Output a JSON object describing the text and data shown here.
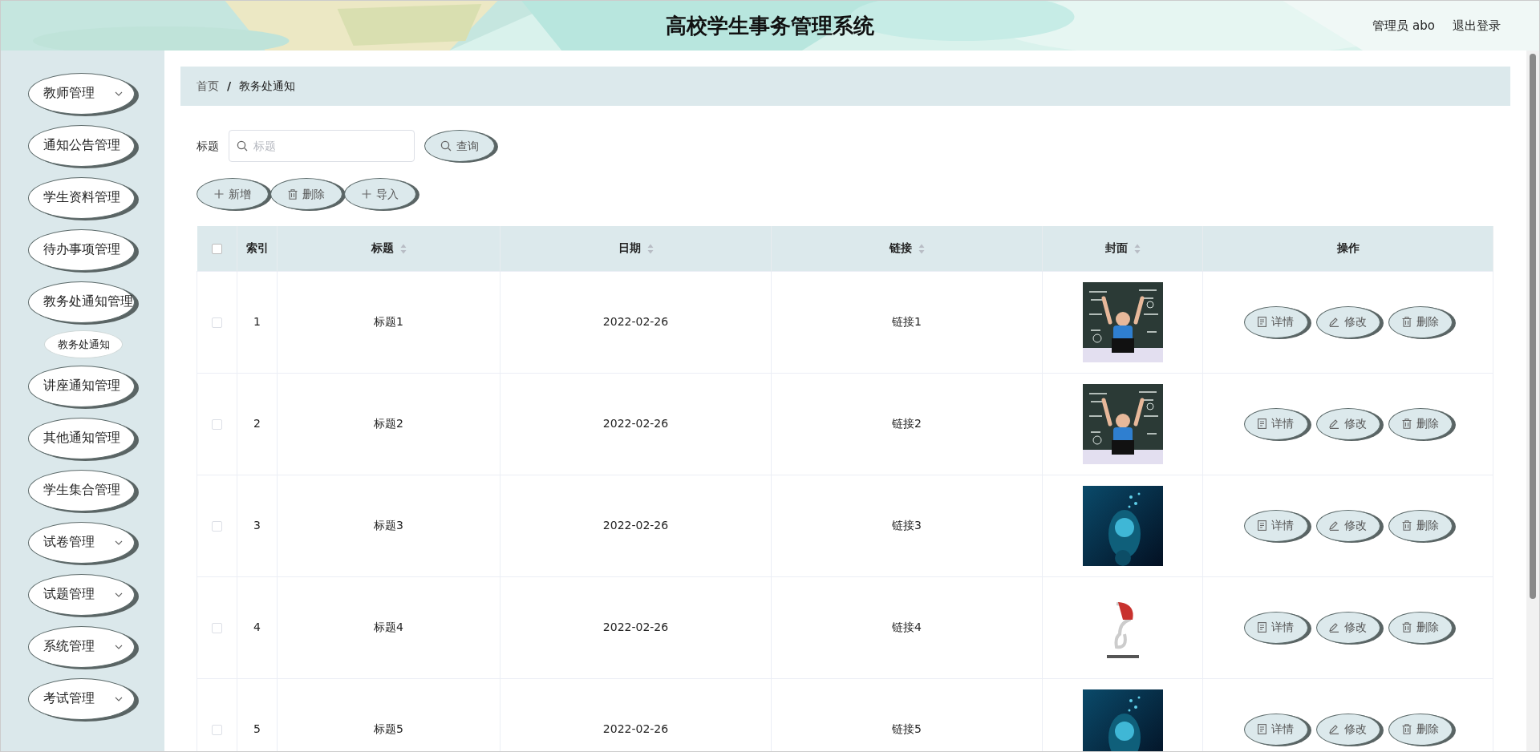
{
  "header": {
    "title": "高校学生事务管理系统",
    "user": "管理员 abo",
    "logout": "退出登录"
  },
  "sidebar": {
    "items": [
      {
        "label": "教师管理",
        "caret": true,
        "expanded": false
      },
      {
        "label": "通知公告管理",
        "caret": false
      },
      {
        "label": "学生资料管理",
        "caret": false
      },
      {
        "label": "待办事项管理",
        "caret": false
      },
      {
        "label": "教务处通知管理",
        "caret": false,
        "expanded": true,
        "children": [
          {
            "label": "教务处通知",
            "selected": true
          }
        ]
      },
      {
        "label": "讲座通知管理",
        "caret": false
      },
      {
        "label": "其他通知管理",
        "caret": false
      },
      {
        "label": "学生集合管理",
        "caret": false
      },
      {
        "label": "试卷管理",
        "caret": true,
        "expanded": false
      },
      {
        "label": "试题管理",
        "caret": true,
        "expanded": false
      },
      {
        "label": "系统管理",
        "caret": true,
        "expanded": false
      },
      {
        "label": "考试管理",
        "caret": true,
        "expanded": false
      }
    ]
  },
  "breadcrumb": {
    "separator": "/",
    "items": [
      "首页",
      "教务处通知"
    ]
  },
  "search": {
    "label": "标题",
    "placeholder": "标题",
    "button": "查询"
  },
  "toolbar": [
    {
      "kind": "add",
      "label": "新增"
    },
    {
      "kind": "delete",
      "label": "删除"
    },
    {
      "kind": "add",
      "label": "导入"
    }
  ],
  "table": {
    "select_all": {
      "checked": false
    },
    "columns": [
      {
        "label": "索引",
        "sortable": false
      },
      {
        "label": "标题",
        "sortable": true
      },
      {
        "label": "日期",
        "sortable": true
      },
      {
        "label": "链接",
        "sortable": true
      },
      {
        "label": "封面",
        "sortable": true
      },
      {
        "label": "操作",
        "sortable": false
      }
    ],
    "rows": [
      {
        "checked": false,
        "index": "1",
        "title": "标题1",
        "date": "2022-02-26",
        "link": "链接1",
        "actions": [
          {
            "kind": "detail",
            "label": "详情"
          },
          {
            "kind": "edit",
            "label": "修改"
          },
          {
            "kind": "delete",
            "label": "删除"
          }
        ]
      },
      {
        "checked": false,
        "index": "2",
        "title": "标题2",
        "date": "2022-02-26",
        "link": "链接2",
        "actions": [
          {
            "kind": "detail",
            "label": "详情"
          },
          {
            "kind": "edit",
            "label": "修改"
          },
          {
            "kind": "delete",
            "label": "删除"
          }
        ]
      },
      {
        "checked": false,
        "index": "3",
        "title": "标题3",
        "date": "2022-02-26",
        "link": "链接3",
        "actions": [
          {
            "kind": "detail",
            "label": "详情"
          },
          {
            "kind": "edit",
            "label": "修改"
          },
          {
            "kind": "delete",
            "label": "删除"
          }
        ]
      },
      {
        "checked": false,
        "index": "4",
        "title": "标题4",
        "date": "2022-02-26",
        "link": "链接4",
        "actions": [
          {
            "kind": "detail",
            "label": "详情"
          },
          {
            "kind": "edit",
            "label": "修改"
          },
          {
            "kind": "delete",
            "label": "删除"
          }
        ]
      },
      {
        "checked": false,
        "index": "5",
        "title": "标题5",
        "date": "2022-02-26",
        "link": "链接5",
        "actions": [
          {
            "kind": "detail",
            "label": "详情"
          },
          {
            "kind": "edit",
            "label": "修改"
          },
          {
            "kind": "delete",
            "label": "删除"
          }
        ]
      }
    ]
  }
}
